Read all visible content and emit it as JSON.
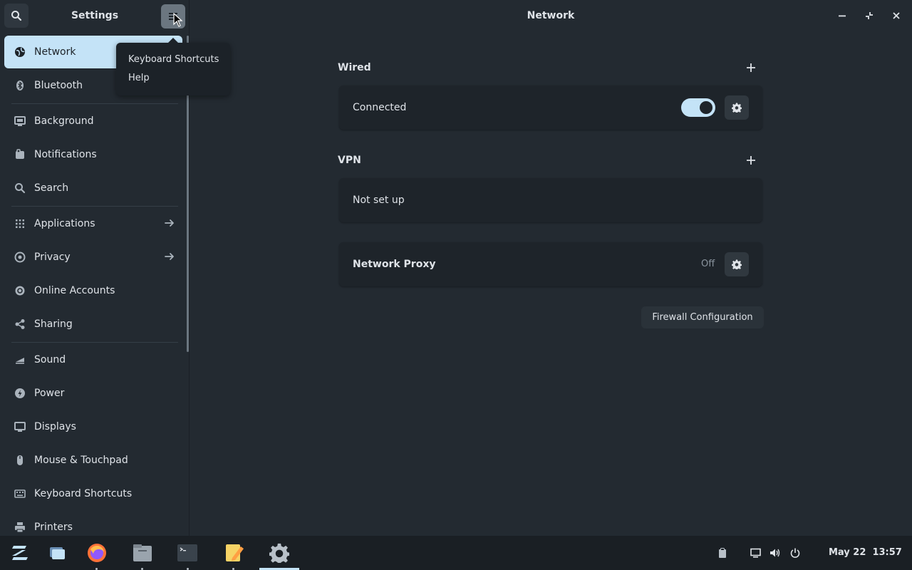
{
  "sidebar": {
    "title": "Settings",
    "items": [
      {
        "label": "Network",
        "icon": "globe-icon"
      },
      {
        "label": "Bluetooth",
        "icon": "bluetooth-icon"
      },
      {
        "label": "Background",
        "icon": "monitor-icon"
      },
      {
        "label": "Notifications",
        "icon": "bell-icon"
      },
      {
        "label": "Search",
        "icon": "search-icon"
      },
      {
        "label": "Applications",
        "icon": "grid-icon"
      },
      {
        "label": "Privacy",
        "icon": "eye-icon"
      },
      {
        "label": "Online Accounts",
        "icon": "at-icon"
      },
      {
        "label": "Sharing",
        "icon": "share-icon"
      },
      {
        "label": "Sound",
        "icon": "speaker-icon"
      },
      {
        "label": "Power",
        "icon": "power-icon"
      },
      {
        "label": "Displays",
        "icon": "display-icon"
      },
      {
        "label": "Mouse & Touchpad",
        "icon": "mouse-icon"
      },
      {
        "label": "Keyboard Shortcuts",
        "icon": "keyboard-icon"
      },
      {
        "label": "Printers",
        "icon": "printer-icon"
      }
    ]
  },
  "menu": {
    "items": [
      "Keyboard Shortcuts",
      "Help"
    ]
  },
  "main": {
    "title": "Network",
    "wired": {
      "title": "Wired",
      "status": "Connected",
      "enabled": true
    },
    "vpn": {
      "title": "VPN",
      "status": "Not set up"
    },
    "proxy": {
      "title": "Network Proxy",
      "status": "Off"
    },
    "firewall_button": "Firewall Configuration"
  },
  "taskbar": {
    "apps": [
      "zorin-menu-icon",
      "window-switcher-icon",
      "firefox-icon",
      "files-icon",
      "terminal-icon",
      "text-editor-icon",
      "settings-icon"
    ],
    "date": "May 22",
    "time": "13:57"
  },
  "colors": {
    "accent": "#c4e3f7",
    "background": "#232a31",
    "card": "#1e242a",
    "taskbar": "#1a1f24"
  }
}
